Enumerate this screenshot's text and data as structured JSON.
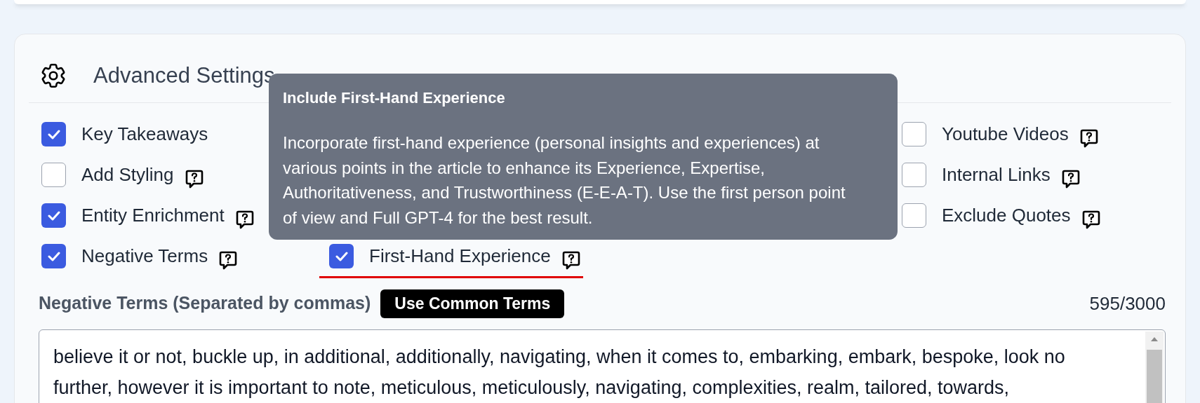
{
  "section": {
    "title": "Advanced Settings"
  },
  "options": [
    [
      {
        "label": "Key Takeaways",
        "checked": true,
        "help": false,
        "underlined": false
      },
      {
        "label": "Add Styling",
        "checked": false,
        "help": true,
        "underlined": false
      },
      {
        "label": "Entity Enrichment",
        "checked": true,
        "help": true,
        "underlined": false
      },
      {
        "label": "Negative Terms",
        "checked": true,
        "help": true,
        "underlined": false
      }
    ],
    [
      {
        "label": "First-Hand Experience",
        "checked": true,
        "help": true,
        "underlined": true
      }
    ],
    [
      {
        "label": "Youtube Videos",
        "checked": false,
        "help": true,
        "underlined": false
      },
      {
        "label": "Internal Links",
        "checked": false,
        "help": true,
        "underlined": false
      },
      {
        "label": "Exclude Quotes",
        "checked": false,
        "help": true,
        "underlined": false
      }
    ]
  ],
  "tooltip": {
    "title": "Include First-Hand Experience",
    "body": "Incorporate first-hand experience (personal insights and experiences) at various points in the article to enhance its Experience, Expertise, Authoritativeness, and Trustworthiness (E-E-A-T). Use the first person point of view and Full GPT-4 for the best result."
  },
  "negative_terms": {
    "label": "Negative Terms (Separated by commas)",
    "button": "Use Common Terms",
    "count": "595/3000",
    "lines": [
      "believe it or not, buckle up, in additional, additionally, navigating, when it comes to, embarking, embark, bespoke, look no",
      "further, however it is important to note, meticulous, meticulously, navigating, complexities, realm, tailored, towards,"
    ]
  }
}
